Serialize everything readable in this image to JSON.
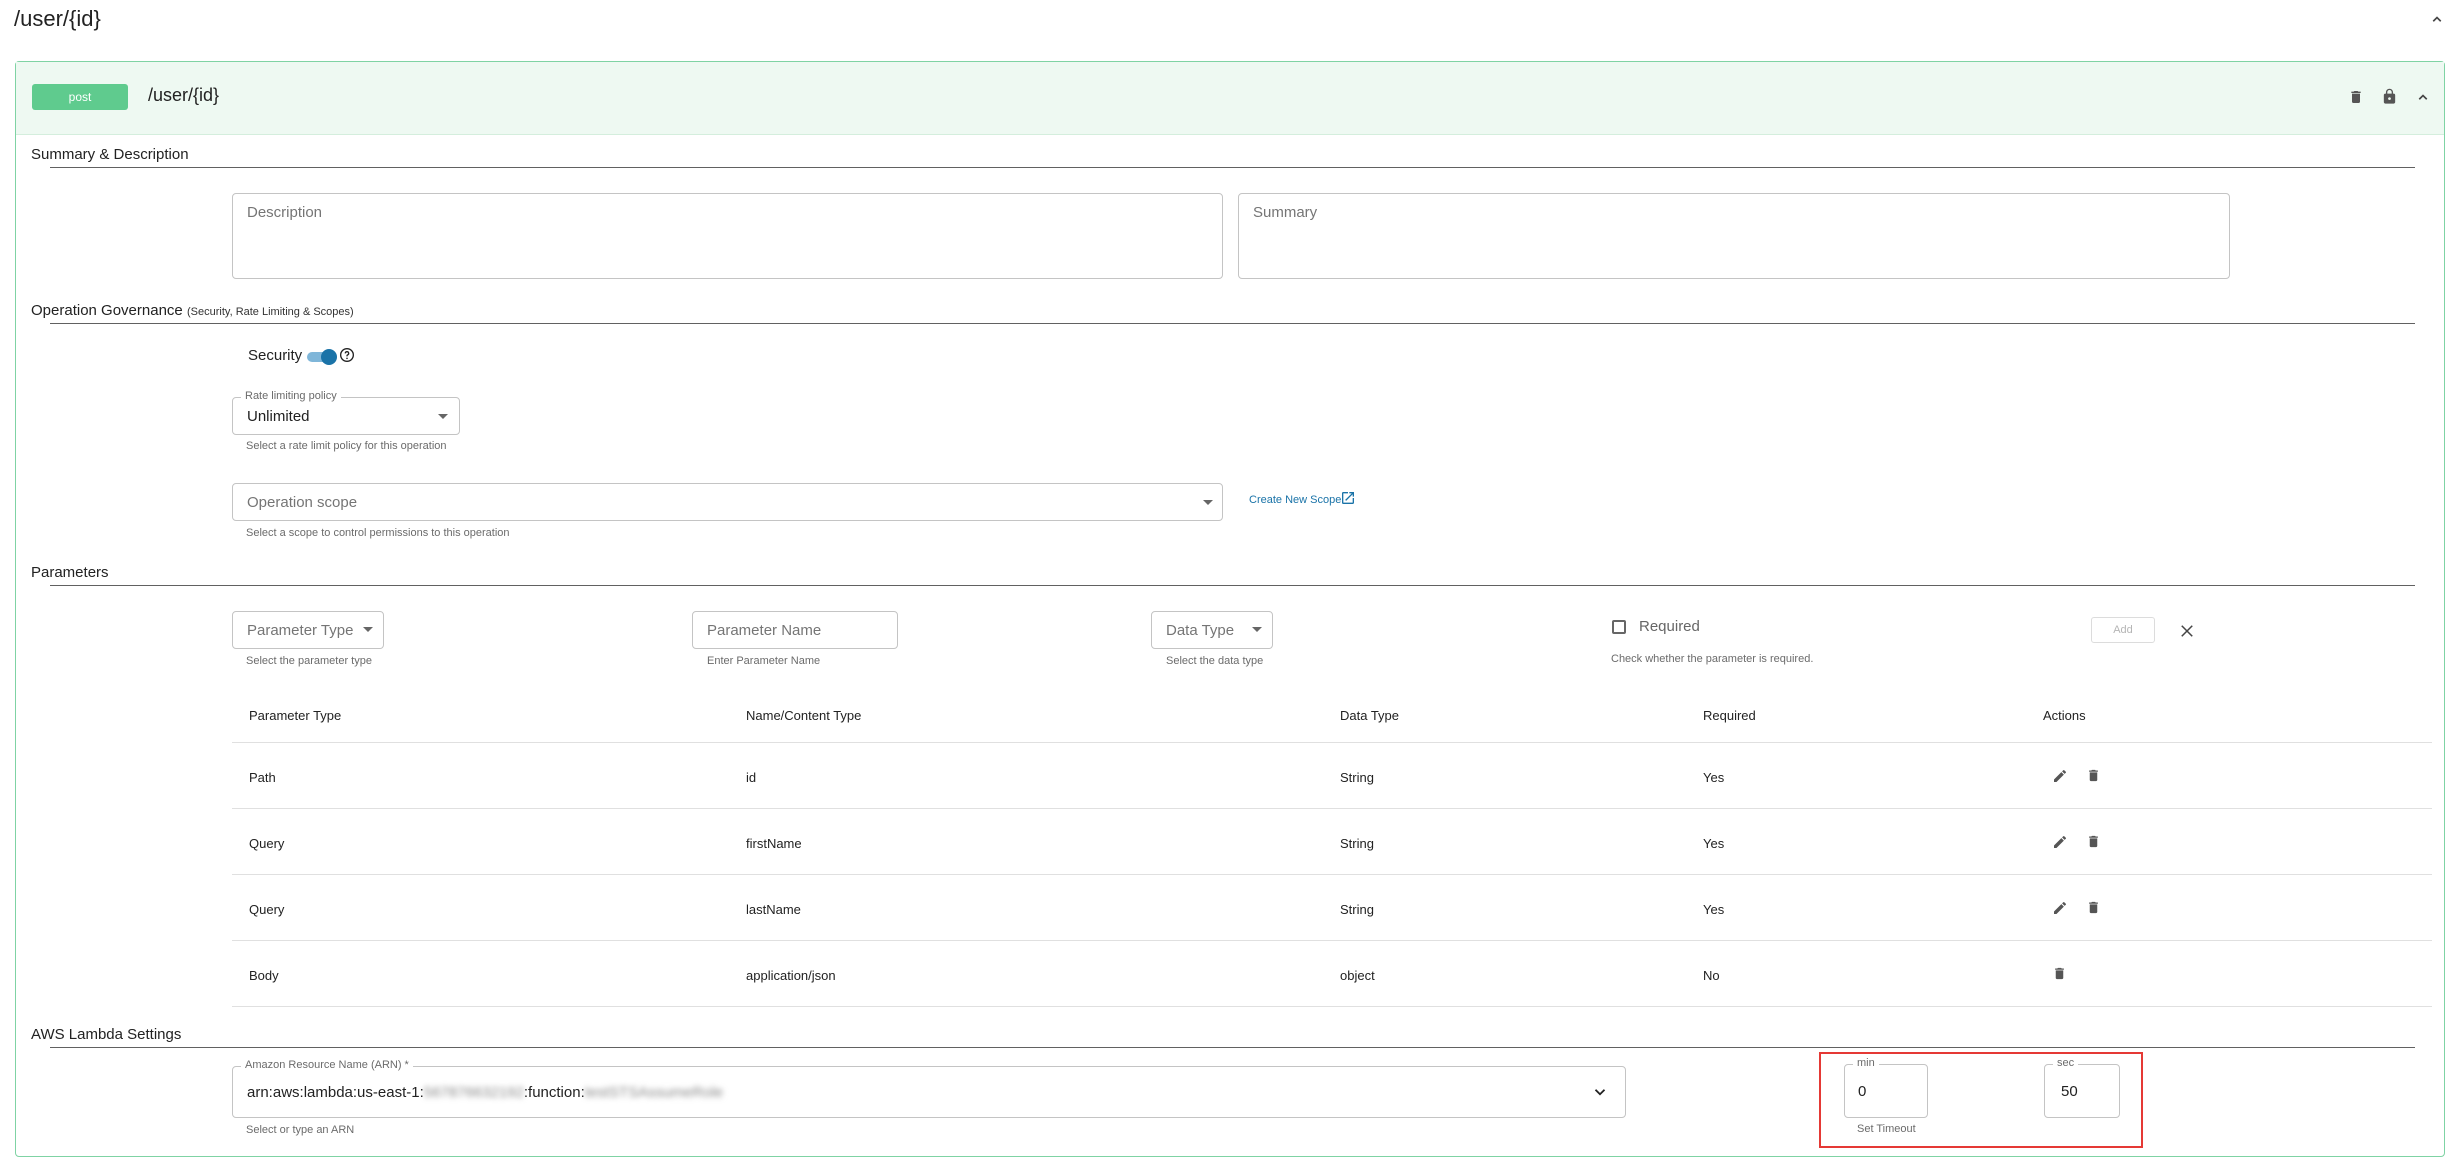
{
  "resource": {
    "path": "/user/{id}"
  },
  "operation": {
    "method": "post",
    "path": "/user/{id}",
    "colors": {
      "method_badge": "#5fcb8e",
      "header_bg": "#eef9f2",
      "border": "#7fd3a4"
    }
  },
  "summary_section": {
    "title": "Summary & Description",
    "description_placeholder": "Description",
    "summary_placeholder": "Summary"
  },
  "governance": {
    "title": "Operation Governance",
    "subtitle": "(Security, Rate Limiting & Scopes)",
    "security_label": "Security",
    "security_enabled": true,
    "rate_limit": {
      "legend": "Rate limiting policy",
      "value": "Unlimited",
      "helper": "Select a rate limit policy for this operation"
    },
    "scope": {
      "placeholder": "Operation scope",
      "helper": "Select a scope to control permissions to this operation",
      "create_link": "Create New Scope"
    }
  },
  "parameters": {
    "title": "Parameters",
    "form": {
      "type_placeholder": "Parameter Type",
      "type_helper": "Select the parameter type",
      "name_placeholder": "Parameter Name",
      "name_helper": "Enter Parameter Name",
      "datatype_placeholder": "Data Type",
      "datatype_helper": "Select the data type",
      "required_label": "Required",
      "required_helper": "Check whether the parameter is required.",
      "add_label": "Add"
    },
    "headers": [
      "Parameter Type",
      "Name/Content Type",
      "Data Type",
      "Required",
      "Actions"
    ],
    "rows": [
      {
        "type": "Path",
        "name": "id",
        "datatype": "String",
        "required": "Yes"
      },
      {
        "type": "Query",
        "name": "firstName",
        "datatype": "String",
        "required": "Yes"
      },
      {
        "type": "Query",
        "name": "lastName",
        "datatype": "String",
        "required": "Yes"
      },
      {
        "type": "Body",
        "name": "application/json",
        "datatype": "object",
        "required": "No"
      }
    ]
  },
  "lambda": {
    "title": "AWS Lambda Settings",
    "arn_legend": "Amazon Resource Name (ARN) *",
    "arn_prefix": "arn:aws:lambda:us-east-1:",
    "arn_account": "567876632192",
    "arn_middle": ":function:",
    "arn_function": "testSTSAssumeRole",
    "arn_helper": "Select or type an ARN",
    "timeout": {
      "min_legend": "min",
      "min_value": "0",
      "sec_legend": "sec",
      "sec_value": "50",
      "helper": "Set Timeout",
      "highlight_color": "#e53935"
    }
  }
}
